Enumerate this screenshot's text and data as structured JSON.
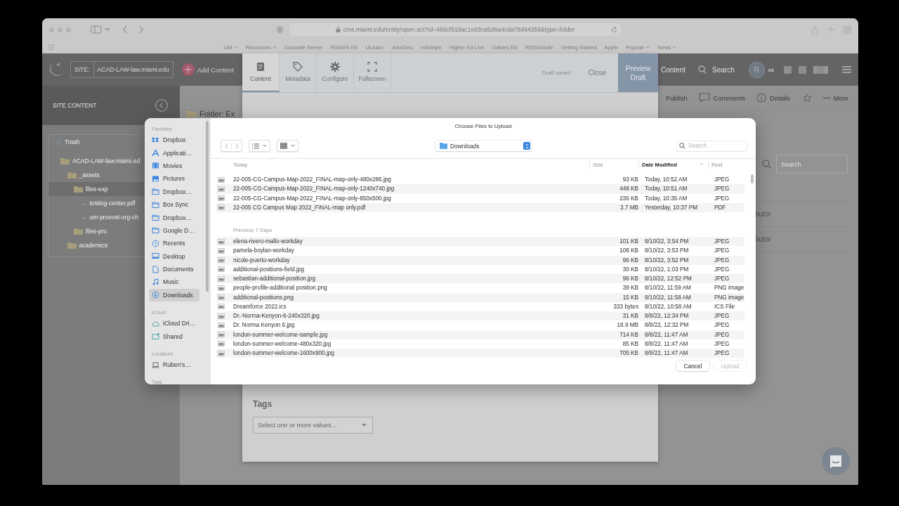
{
  "browser": {
    "url": "cms.miami.edu/entity/open.act?id=466cf919ac1e03ca5d6a4cda78d44359&type=folder",
    "bookmarks": [
      {
        "label": "UM",
        "menu": true
      },
      {
        "label": "Resources",
        "menu": true
      },
      {
        "label": "Cascade Server",
        "menu": false
      },
      {
        "label": "RSMAS EE",
        "menu": false
      },
      {
        "label": "ULearn",
        "menu": false
      },
      {
        "label": ".eduGuru",
        "menu": false
      },
      {
        "label": "eduStyle",
        "menu": false
      },
      {
        "label": "Higher Ed Live",
        "menu": false
      },
      {
        "label": "Gables EE",
        "menu": false
      },
      {
        "label": "RSSinclude",
        "menu": false
      },
      {
        "label": "Getting Started",
        "menu": false
      },
      {
        "label": "Apple",
        "menu": false
      },
      {
        "label": "Popular",
        "menu": true
      },
      {
        "label": "News",
        "menu": true
      }
    ]
  },
  "cms": {
    "site_label": "SITE:",
    "site": "ACAD-LAW-law.miami.edu",
    "add_content": "Add Content",
    "nav": [
      {
        "label": "Content",
        "kind": "text"
      },
      {
        "label": "Search",
        "kind": "search"
      }
    ],
    "avatar": "R",
    "user_prefix": "as",
    "sidebar": {
      "title": "SITE CONTENT",
      "tree": [
        {
          "label": "Trash",
          "kind": "trash",
          "selected": false
        },
        {
          "label": "ACAD-LAW-law.miami.ed",
          "kind": "folder",
          "selected": false,
          "children": [
            {
              "label": "_assets",
              "kind": "folder",
              "selected": false,
              "children": [
                {
                  "label": "files-exp",
                  "kind": "folder",
                  "selected": true,
                  "children": [
                    {
                      "label": "testing-center.pdf",
                      "kind": "file",
                      "selected": false
                    },
                    {
                      "label": "um-provost-org-ch",
                      "kind": "file",
                      "selected": false
                    }
                  ]
                },
                {
                  "label": "files-pro",
                  "kind": "folder",
                  "selected": false
                }
              ]
            },
            {
              "label": "academics",
              "kind": "folder",
              "selected": false
            }
          ]
        }
      ]
    },
    "actions": [
      {
        "label": "Publish",
        "kind": "text"
      },
      {
        "label": "Comments",
        "kind": "comments"
      },
      {
        "label": "Details",
        "kind": "details"
      },
      {
        "label": "More",
        "kind": "more"
      }
    ],
    "folder_title": "Folder: Ex",
    "search_placeholder": "Search",
    "rows": [
      "butor",
      "butor"
    ]
  },
  "editor": {
    "tabs": [
      {
        "label": "Content",
        "kind": "document",
        "selected": true
      },
      {
        "label": "Metadata",
        "kind": "tag",
        "selected": false
      },
      {
        "label": "Configure",
        "kind": "gear",
        "selected": false
      },
      {
        "label": "Fullscreen",
        "kind": "expand",
        "selected": false
      }
    ],
    "status": "Draft saved",
    "close": "Close",
    "preview": "Preview Draft",
    "tags_label": "Tags",
    "tags_placeholder": "Select one or more values..."
  },
  "dialog": {
    "title": "Choose Files to Upload",
    "location": "Downloads",
    "search_placeholder": "Search",
    "sidebar": [
      {
        "heading": "Favorites",
        "items": [
          {
            "label": "Dropbox",
            "kind": "dropbox",
            "selected": false
          },
          {
            "label": "Applicati…",
            "kind": "apps",
            "selected": false
          },
          {
            "label": "Movies",
            "kind": "film",
            "selected": false
          },
          {
            "label": "Pictures",
            "kind": "photo",
            "selected": false
          },
          {
            "label": "Dropbox…",
            "kind": "folder",
            "selected": false
          },
          {
            "label": "Box Sync",
            "kind": "folder",
            "selected": false
          },
          {
            "label": "Dropbox…",
            "kind": "folder",
            "selected": false
          },
          {
            "label": "Google D…",
            "kind": "folder",
            "selected": false
          },
          {
            "label": "Recents",
            "kind": "clock",
            "selected": false
          },
          {
            "label": "Desktop",
            "kind": "desktop",
            "selected": false
          },
          {
            "label": "Documents",
            "kind": "doc",
            "selected": false
          },
          {
            "label": "Music",
            "kind": "music",
            "selected": false
          },
          {
            "label": "Downloads",
            "kind": "download",
            "selected": true
          }
        ]
      },
      {
        "heading": "iCloud",
        "items": [
          {
            "label": "iCloud Dri…",
            "kind": "cloud",
            "selected": false
          },
          {
            "label": "Shared",
            "kind": "shared",
            "selected": false
          }
        ]
      },
      {
        "heading": "Locations",
        "items": [
          {
            "label": "Ruben's…",
            "kind": "laptop",
            "selected": false
          }
        ]
      },
      {
        "heading": "Tags"
      }
    ],
    "columns": [
      {
        "label": "Size",
        "sorted": false
      },
      {
        "label": "Date Modified",
        "sorted": true
      },
      {
        "label": "Kind",
        "sorted": false
      }
    ],
    "groups": [
      {
        "label": "Today",
        "rows": [
          {
            "name": "22-005-CG-Campus-Map-2022_FINAL-map-only-480x286.jpg",
            "size": "93 KB",
            "date": "Today, 10:52 AM",
            "kind": "JPEG"
          },
          {
            "name": "22-005-CG-Campus-Map-2022_FINAL-map-only-1240x740.jpg",
            "size": "448 KB",
            "date": "Today, 10:51 AM",
            "kind": "JPEG"
          },
          {
            "name": "22-005-CG-Campus-Map-2022_FINAL-map-only-850x500.jpg",
            "size": "236 KB",
            "date": "Today, 10:35 AM",
            "kind": "JPEG"
          },
          {
            "name": "22-005 CG Campus Map 2022_FINAL-map only.pdf",
            "size": "3.7 MB",
            "date": "Yesterday, 10:37 PM",
            "kind": "PDF"
          }
        ]
      },
      {
        "label": "Previous 7 Days",
        "rows": [
          {
            "name": "elena-rivero-mallo-workday",
            "size": "101 KB",
            "date": "8/10/22, 3:54 PM",
            "kind": "JPEG"
          },
          {
            "name": "pamela-boylan-workday",
            "size": "108 KB",
            "date": "8/10/22, 3:53 PM",
            "kind": "JPEG"
          },
          {
            "name": "nicole-puerto-workday",
            "size": "96 KB",
            "date": "8/10/22, 3:52 PM",
            "kind": "JPEG"
          },
          {
            "name": "additional-positions-field.jpg",
            "size": "30 KB",
            "date": "8/10/22, 1:03 PM",
            "kind": "JPEG"
          },
          {
            "name": "sebastian-additional-position.jpg",
            "size": "96 KB",
            "date": "8/10/22, 12:52 PM",
            "kind": "JPEG"
          },
          {
            "name": "people-profile-additional position.png",
            "size": "39 KB",
            "date": "8/10/22, 11:59 AM",
            "kind": "PNG image"
          },
          {
            "name": "additional-positions.png",
            "size": "15 KB",
            "date": "8/10/22, 11:58 AM",
            "kind": "PNG image"
          },
          {
            "name": "Dreamforce 2022.ics",
            "size": "333 bytes",
            "date": "8/10/22, 10:58 AM",
            "kind": "ICS File"
          },
          {
            "name": "Dr.-Norma-Kenyon-6-240x320.jpg",
            "size": "31 KB",
            "date": "8/8/22, 12:34 PM",
            "kind": "JPEG"
          },
          {
            "name": "Dr. Norma Kenyon 6.jpg",
            "size": "18.9 MB",
            "date": "8/8/22, 12:32 PM",
            "kind": "JPEG"
          },
          {
            "name": "london-summer-welcome-sample.jpg",
            "size": "714 KB",
            "date": "8/8/22, 11:47 AM",
            "kind": "JPEG"
          },
          {
            "name": "london-summer-welcome-480x320.jpg",
            "size": "85 KB",
            "date": "8/8/22, 11:47 AM",
            "kind": "JPEG"
          },
          {
            "name": "london-summer-welcome-1600x900.jpg",
            "size": "705 KB",
            "date": "8/8/22, 11:47 AM",
            "kind": "JPEG"
          }
        ]
      }
    ],
    "buttons": [
      {
        "label": "Cancel",
        "disabled": false
      },
      {
        "label": "Upload",
        "disabled": true
      }
    ]
  }
}
